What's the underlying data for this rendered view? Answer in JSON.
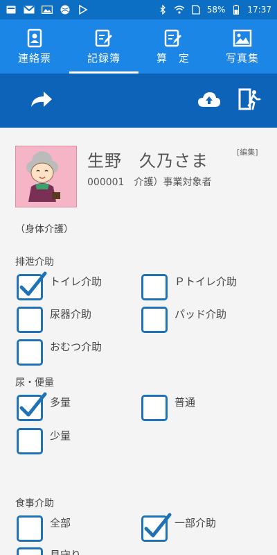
{
  "status": {
    "battery": "58%",
    "time": "17:37"
  },
  "tabs": [
    {
      "label": "連絡票",
      "icon": "contact-card-icon",
      "active": false
    },
    {
      "label": "記録簿",
      "icon": "record-edit-icon",
      "active": true
    },
    {
      "label": "算　定",
      "icon": "calc-edit-icon",
      "active": false
    },
    {
      "label": "写真集",
      "icon": "photo-icon",
      "active": false
    }
  ],
  "profile": {
    "name": "生野　久乃さま",
    "id_and_type": "000001　介護）事業対象者",
    "edit_label": "[編集]"
  },
  "care_category": "（身体介護）",
  "sections": [
    {
      "title": "排泄介助",
      "items": [
        {
          "label": "トイレ介助",
          "checked": true
        },
        {
          "label": "Ｐトイレ介助",
          "checked": false
        },
        {
          "label": "尿器介助",
          "checked": false
        },
        {
          "label": "パッド介助",
          "checked": false
        },
        {
          "label": "おむつ介助",
          "checked": false
        }
      ]
    },
    {
      "title": "尿・便量",
      "items": [
        {
          "label": "多量",
          "checked": true
        },
        {
          "label": "普通",
          "checked": false
        },
        {
          "label": "少量",
          "checked": false
        }
      ]
    },
    {
      "title": "食事介助",
      "items": [
        {
          "label": "全部",
          "checked": false
        },
        {
          "label": "一部介助",
          "checked": true
        },
        {
          "label": "見守り",
          "checked": false
        }
      ]
    }
  ],
  "colors": {
    "tab_bg": "#1b86e6",
    "toolbar_bg": "#0d63b8",
    "checkbox": "#1f72b6"
  }
}
